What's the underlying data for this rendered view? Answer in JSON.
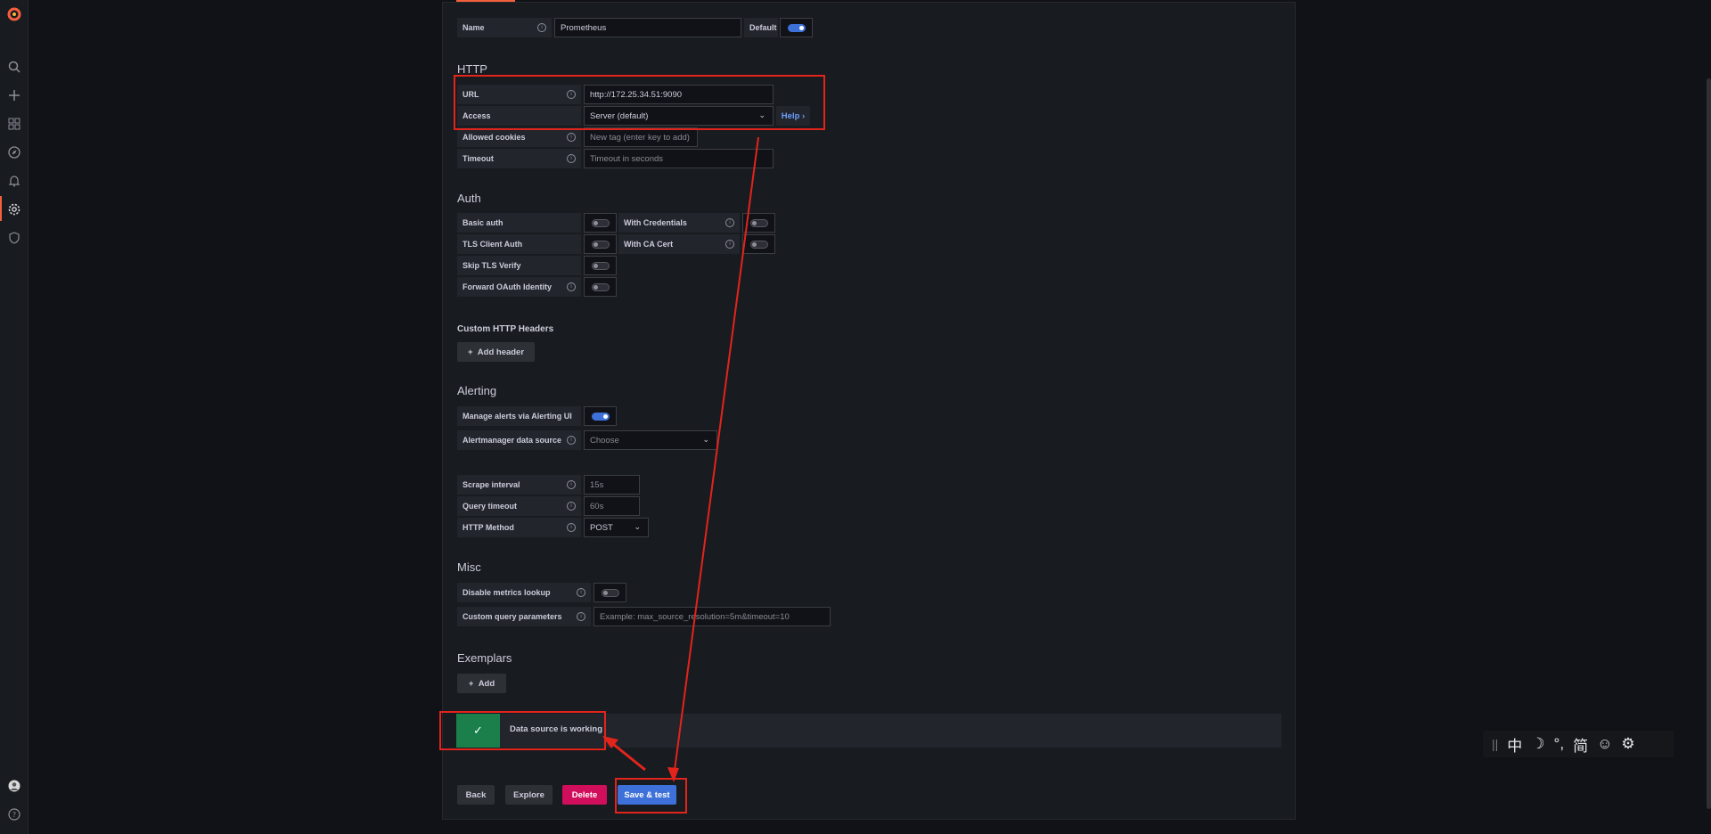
{
  "name_field": {
    "label": "Name",
    "value": "Prometheus",
    "default_label": "Default",
    "default_on": true
  },
  "http": {
    "title": "HTTP",
    "url_label": "URL",
    "url_value": "http://172.25.34.51:9090",
    "access_label": "Access",
    "access_value": "Server (default)",
    "help_label": "Help",
    "cookies_label": "Allowed cookies",
    "cookies_placeholder": "New tag (enter key to add)",
    "timeout_label": "Timeout",
    "timeout_placeholder": "Timeout in seconds"
  },
  "auth": {
    "title": "Auth",
    "basic_auth": "Basic auth",
    "with_credentials": "With Credentials",
    "tls_client_auth": "TLS Client Auth",
    "with_ca_cert": "With CA Cert",
    "skip_tls_verify": "Skip TLS Verify",
    "forward_oauth": "Forward OAuth Identity"
  },
  "headers": {
    "title": "Custom HTTP Headers",
    "add_label": "Add header"
  },
  "alerting": {
    "title": "Alerting",
    "manage_label": "Manage alerts via Alerting UI",
    "manage_on": true,
    "am_label": "Alertmanager data source",
    "am_placeholder": "Choose"
  },
  "prom": {
    "scrape_label": "Scrape interval",
    "scrape_placeholder": "15s",
    "query_timeout_label": "Query timeout",
    "query_timeout_placeholder": "60s",
    "method_label": "HTTP Method",
    "method_value": "POST"
  },
  "misc": {
    "title": "Misc",
    "disable_metrics_label": "Disable metrics lookup",
    "custom_params_label": "Custom query parameters",
    "custom_params_placeholder": "Example: max_source_resolution=5m&timeout=10"
  },
  "exemplars": {
    "title": "Exemplars",
    "add_label": "Add"
  },
  "alert": {
    "message": "Data source is working",
    "status_color": "#1a7f4b"
  },
  "buttons": {
    "back": "Back",
    "explore": "Explore",
    "delete": "Delete",
    "save": "Save & test"
  },
  "ime": {
    "items": [
      "中",
      "☽",
      "°,",
      "简",
      "☺",
      "⚙"
    ]
  },
  "colors": {
    "accent": "#3d71d9",
    "danger": "#d10e5c",
    "annotation": "#e3241c",
    "brand": "#f55f3e"
  }
}
